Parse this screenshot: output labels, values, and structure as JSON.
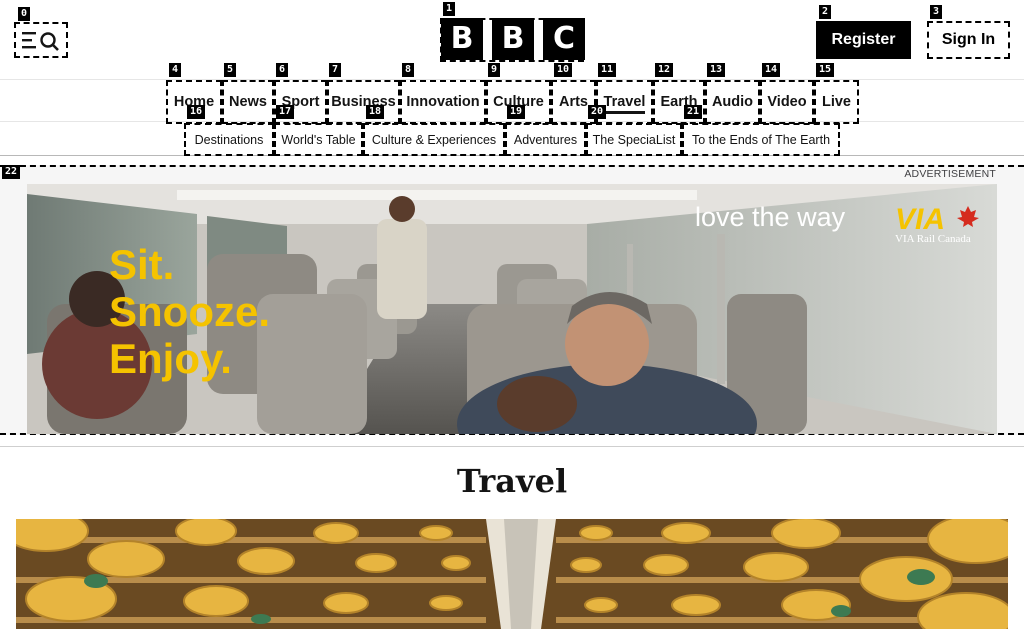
{
  "header": {
    "logo_letters": [
      "B",
      "B",
      "C"
    ],
    "register_label": "Register",
    "signin_label": "Sign In"
  },
  "nav": {
    "items": [
      {
        "label": "Home"
      },
      {
        "label": "News"
      },
      {
        "label": "Sport"
      },
      {
        "label": "Business"
      },
      {
        "label": "Innovation"
      },
      {
        "label": "Culture"
      },
      {
        "label": "Arts"
      },
      {
        "label": "Travel",
        "active": true
      },
      {
        "label": "Earth"
      },
      {
        "label": "Audio"
      },
      {
        "label": "Video"
      },
      {
        "label": "Live"
      }
    ]
  },
  "subnav": {
    "items": [
      {
        "label": "Destinations"
      },
      {
        "label": "World's Table"
      },
      {
        "label": "Culture & Experiences"
      },
      {
        "label": "Adventures"
      },
      {
        "label": "The SpeciaList"
      },
      {
        "label": "To the Ends of The Earth"
      }
    ]
  },
  "ad": {
    "label": "ADVERTISEMENT",
    "headline_lines": [
      "Sit.",
      "Snooze.",
      "Enjoy."
    ],
    "tagline": "love the way",
    "brand": "VIA",
    "brand_sub": "VIA Rail Canada",
    "colors": {
      "headline": "#f5c300",
      "brand": "#f5c300",
      "maple": "#d52b1e"
    }
  },
  "page": {
    "title": "Travel"
  },
  "tags": [
    "0",
    "1",
    "2",
    "3",
    "4",
    "5",
    "6",
    "7",
    "8",
    "9",
    "10",
    "11",
    "12",
    "13",
    "14",
    "15",
    "16",
    "17",
    "18",
    "19",
    "20",
    "21",
    "22"
  ]
}
